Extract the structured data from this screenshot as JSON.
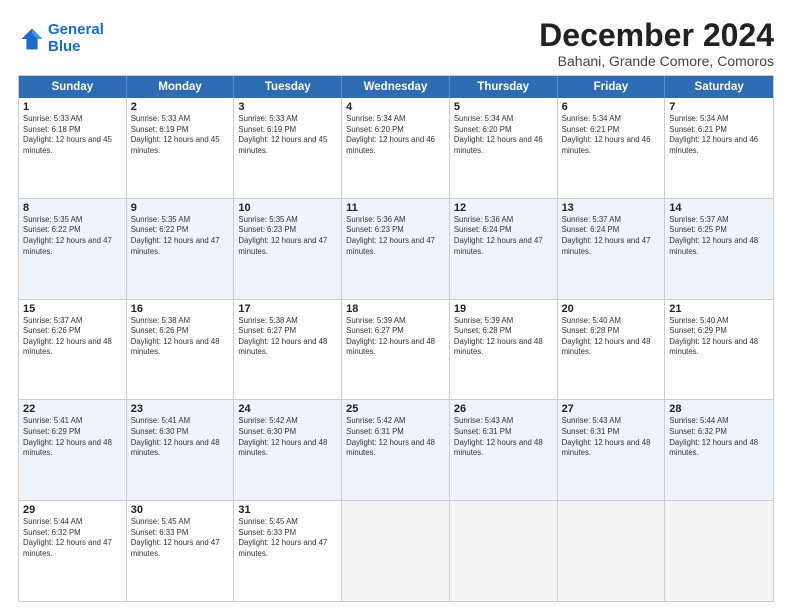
{
  "logo": {
    "line1": "General",
    "line2": "Blue"
  },
  "title": "December 2024",
  "subtitle": "Bahani, Grande Comore, Comoros",
  "days": [
    "Sunday",
    "Monday",
    "Tuesday",
    "Wednesday",
    "Thursday",
    "Friday",
    "Saturday"
  ],
  "rows": [
    [
      {
        "day": "1",
        "sunrise": "5:33 AM",
        "sunset": "6:18 PM",
        "daylight": "12 hours and 45 minutes."
      },
      {
        "day": "2",
        "sunrise": "5:33 AM",
        "sunset": "6:19 PM",
        "daylight": "12 hours and 45 minutes."
      },
      {
        "day": "3",
        "sunrise": "5:33 AM",
        "sunset": "6:19 PM",
        "daylight": "12 hours and 45 minutes."
      },
      {
        "day": "4",
        "sunrise": "5:34 AM",
        "sunset": "6:20 PM",
        "daylight": "12 hours and 46 minutes."
      },
      {
        "day": "5",
        "sunrise": "5:34 AM",
        "sunset": "6:20 PM",
        "daylight": "12 hours and 46 minutes."
      },
      {
        "day": "6",
        "sunrise": "5:34 AM",
        "sunset": "6:21 PM",
        "daylight": "12 hours and 46 minutes."
      },
      {
        "day": "7",
        "sunrise": "5:34 AM",
        "sunset": "6:21 PM",
        "daylight": "12 hours and 46 minutes."
      }
    ],
    [
      {
        "day": "8",
        "sunrise": "5:35 AM",
        "sunset": "6:22 PM",
        "daylight": "12 hours and 47 minutes."
      },
      {
        "day": "9",
        "sunrise": "5:35 AM",
        "sunset": "6:22 PM",
        "daylight": "12 hours and 47 minutes."
      },
      {
        "day": "10",
        "sunrise": "5:35 AM",
        "sunset": "6:23 PM",
        "daylight": "12 hours and 47 minutes."
      },
      {
        "day": "11",
        "sunrise": "5:36 AM",
        "sunset": "6:23 PM",
        "daylight": "12 hours and 47 minutes."
      },
      {
        "day": "12",
        "sunrise": "5:36 AM",
        "sunset": "6:24 PM",
        "daylight": "12 hours and 47 minutes."
      },
      {
        "day": "13",
        "sunrise": "5:37 AM",
        "sunset": "6:24 PM",
        "daylight": "12 hours and 47 minutes."
      },
      {
        "day": "14",
        "sunrise": "5:37 AM",
        "sunset": "6:25 PM",
        "daylight": "12 hours and 48 minutes."
      }
    ],
    [
      {
        "day": "15",
        "sunrise": "5:37 AM",
        "sunset": "6:26 PM",
        "daylight": "12 hours and 48 minutes."
      },
      {
        "day": "16",
        "sunrise": "5:38 AM",
        "sunset": "6:26 PM",
        "daylight": "12 hours and 48 minutes."
      },
      {
        "day": "17",
        "sunrise": "5:38 AM",
        "sunset": "6:27 PM",
        "daylight": "12 hours and 48 minutes."
      },
      {
        "day": "18",
        "sunrise": "5:39 AM",
        "sunset": "6:27 PM",
        "daylight": "12 hours and 48 minutes."
      },
      {
        "day": "19",
        "sunrise": "5:39 AM",
        "sunset": "6:28 PM",
        "daylight": "12 hours and 48 minutes."
      },
      {
        "day": "20",
        "sunrise": "5:40 AM",
        "sunset": "6:28 PM",
        "daylight": "12 hours and 48 minutes."
      },
      {
        "day": "21",
        "sunrise": "5:40 AM",
        "sunset": "6:29 PM",
        "daylight": "12 hours and 48 minutes."
      }
    ],
    [
      {
        "day": "22",
        "sunrise": "5:41 AM",
        "sunset": "6:29 PM",
        "daylight": "12 hours and 48 minutes."
      },
      {
        "day": "23",
        "sunrise": "5:41 AM",
        "sunset": "6:30 PM",
        "daylight": "12 hours and 48 minutes."
      },
      {
        "day": "24",
        "sunrise": "5:42 AM",
        "sunset": "6:30 PM",
        "daylight": "12 hours and 48 minutes."
      },
      {
        "day": "25",
        "sunrise": "5:42 AM",
        "sunset": "6:31 PM",
        "daylight": "12 hours and 48 minutes."
      },
      {
        "day": "26",
        "sunrise": "5:43 AM",
        "sunset": "6:31 PM",
        "daylight": "12 hours and 48 minutes."
      },
      {
        "day": "27",
        "sunrise": "5:43 AM",
        "sunset": "6:31 PM",
        "daylight": "12 hours and 48 minutes."
      },
      {
        "day": "28",
        "sunrise": "5:44 AM",
        "sunset": "6:32 PM",
        "daylight": "12 hours and 48 minutes."
      }
    ],
    [
      {
        "day": "29",
        "sunrise": "5:44 AM",
        "sunset": "6:32 PM",
        "daylight": "12 hours and 47 minutes."
      },
      {
        "day": "30",
        "sunrise": "5:45 AM",
        "sunset": "6:33 PM",
        "daylight": "12 hours and 47 minutes."
      },
      {
        "day": "31",
        "sunrise": "5:45 AM",
        "sunset": "6:33 PM",
        "daylight": "12 hours and 47 minutes."
      },
      {
        "day": "",
        "sunrise": "",
        "sunset": "",
        "daylight": ""
      },
      {
        "day": "",
        "sunrise": "",
        "sunset": "",
        "daylight": ""
      },
      {
        "day": "",
        "sunrise": "",
        "sunset": "",
        "daylight": ""
      },
      {
        "day": "",
        "sunrise": "",
        "sunset": "",
        "daylight": ""
      }
    ]
  ]
}
